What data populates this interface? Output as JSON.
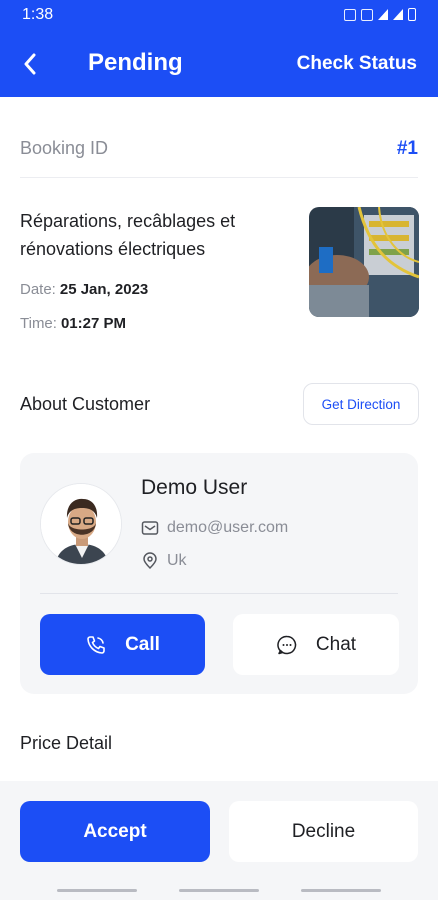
{
  "status_bar": {
    "time": "1:38"
  },
  "header": {
    "title": "Pending",
    "action_label": "Check Status"
  },
  "booking": {
    "label": "Booking ID",
    "id": "#1"
  },
  "service": {
    "title": "Réparations, recâblages et rénovations électriques",
    "date_label": "Date:",
    "date": "25 Jan, 2023",
    "time_label": "Time:",
    "time": "01:27 PM"
  },
  "about": {
    "title": "About Customer",
    "direction_label": "Get Direction"
  },
  "customer": {
    "name": "Demo User",
    "email": "demo@user.com",
    "location": "Uk",
    "call_label": "Call",
    "chat_label": "Chat"
  },
  "price": {
    "title": "Price Detail"
  },
  "actions": {
    "accept_label": "Accept",
    "decline_label": "Decline"
  },
  "colors": {
    "primary": "#1C4EF5",
    "muted_text": "#8A8D96",
    "card_bg": "#F5F6F8"
  }
}
